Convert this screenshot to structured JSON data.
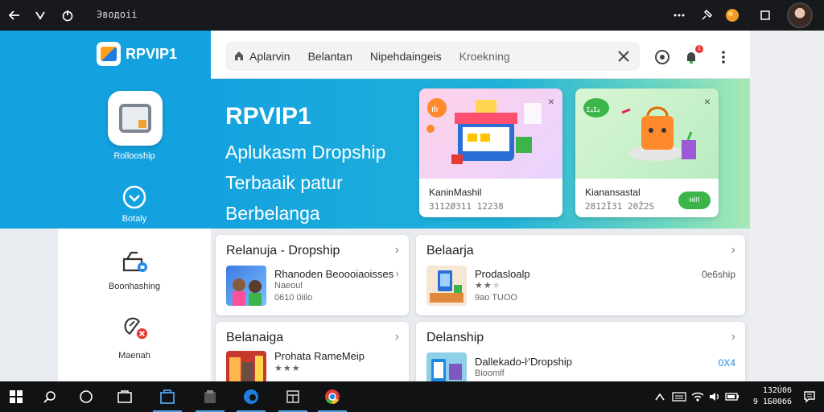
{
  "browser": {
    "address_text": "Эводоіі",
    "nav_icons": [
      "back-arrow-icon",
      "dropdown-chevron-icon",
      "power-icon"
    ],
    "right_icons": [
      "more-icon",
      "extensions-icon",
      "profile-blob-icon",
      "window-icon"
    ]
  },
  "sidebar": {
    "logo_text": "RPVIP1",
    "items": [
      {
        "label": "Rollooship",
        "icon": "store-card-icon"
      },
      {
        "label": "Botaly",
        "icon": "check-chevron-icon"
      },
      {
        "label": "Boonhashing",
        "icon": "bag-icon"
      },
      {
        "label": "Maenah",
        "icon": "wallet-icon"
      }
    ]
  },
  "search": {
    "segments": [
      "Aplarvin",
      "Belantan",
      "Nipehdaingeis",
      "Kroekning"
    ],
    "home_icon": "home-icon",
    "clear_icon": "close-icon"
  },
  "header_icons": {
    "notification_badge": "1"
  },
  "hero": {
    "title": "RPVIP1",
    "subtitle_lines": [
      "Aplukasm Dropship",
      "Terbaaik patur",
      "Berbelanga"
    ],
    "promos": [
      {
        "badge": "ıłı",
        "title": "KaninMashil",
        "meta": "3112Ø311 12238"
      },
      {
        "badge": "ɪ₄ɪ₄",
        "title": "Kianansastal",
        "meta": "2812ȈЗ1 20Ž2S",
        "button": "ніп"
      }
    ]
  },
  "cards": [
    {
      "title": "Relanuja - Dropship",
      "item_name": "Rhanoden Beoooiaoisses",
      "item_sub": "Naeoul",
      "item_meta": "0610 0iilo",
      "price": ""
    },
    {
      "title": "Belaarja",
      "item_name": "Prodasloalp",
      "item_sub": "",
      "item_meta": "9ao TUOO",
      "price": "0e6ship",
      "rating": 2
    },
    {
      "title": "Belanaiga",
      "item_name": "Prohata RameMeip",
      "item_sub": "",
      "item_meta": "",
      "price": "",
      "rating": 3
    },
    {
      "title": "Delanship",
      "item_name": "Dallekado-ŀ'Dropship",
      "item_sub": "Bioomlf",
      "item_meta": "",
      "price": "0X4"
    }
  ],
  "taskbar": {
    "clock_time": "1З2Ú0б",
    "clock_date": "9 1Б00б6"
  },
  "colors": {
    "brand_blue": "#13a2df",
    "accent_green": "#3bb54a",
    "star": "#f4b400",
    "badge_red": "#e53935"
  }
}
